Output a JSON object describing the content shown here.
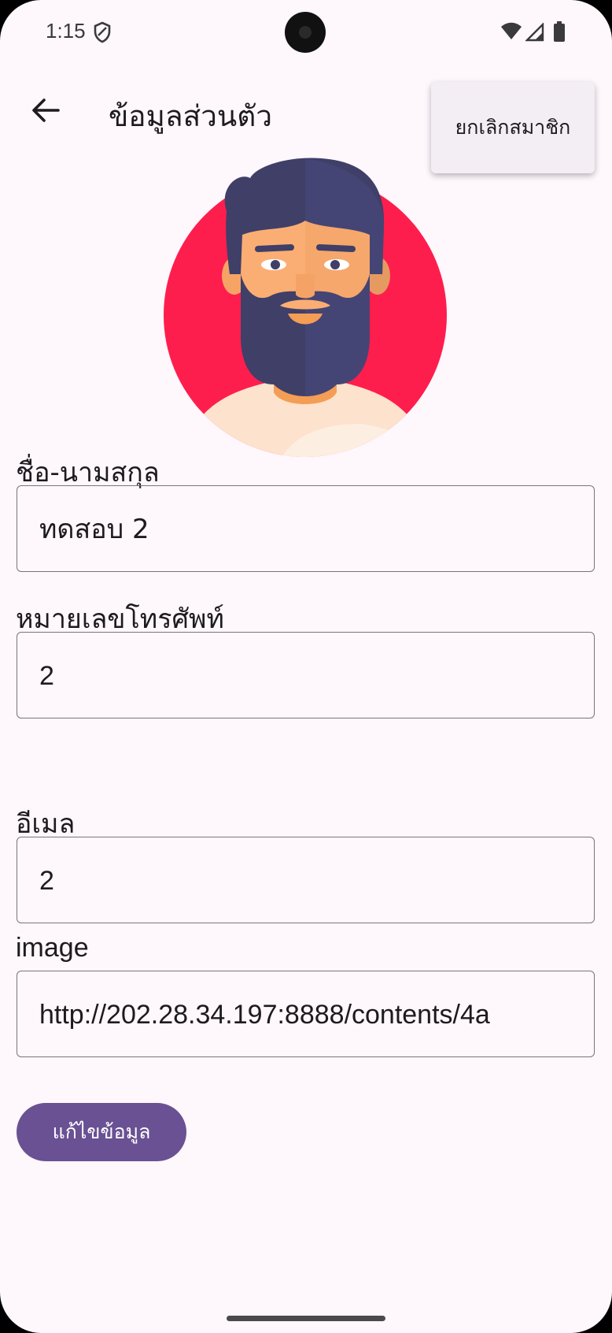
{
  "status_bar": {
    "time": "1:15"
  },
  "appbar": {
    "title": "ข้อมูลส่วนตัว"
  },
  "menu": {
    "items": [
      {
        "label": "ยกเลิกสมาชิก"
      }
    ]
  },
  "form": {
    "fields": [
      {
        "label": "ชื่อ-นามสกุล",
        "value": "ทดสอบ 2"
      },
      {
        "label": "หมายเลขโทรศัพท์",
        "value": "2"
      },
      {
        "label": "อีเมล",
        "value": "2"
      },
      {
        "label": "image",
        "value": "http://202.28.34.197:8888/contents/4a"
      }
    ],
    "submit_label": "แก้ไขข้อมูล"
  },
  "colors": {
    "background": "#fef7fc",
    "primary": "#6a5193",
    "avatar_circle": "#fe1e4e",
    "hair_beard": "#3f3f68",
    "skin": "#fbae73"
  }
}
